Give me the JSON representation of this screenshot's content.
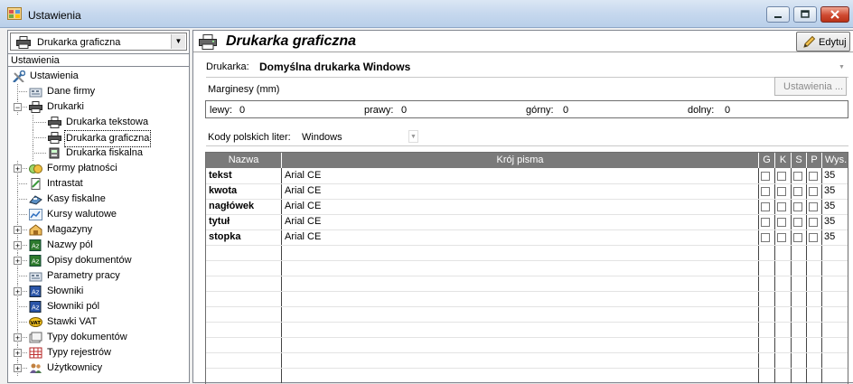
{
  "window": {
    "title": "Ustawienia"
  },
  "left": {
    "combo_value": "Drukarka graficzna",
    "tree_header": "Ustawienia",
    "tree": [
      {
        "label": "Ustawienia",
        "level": 0,
        "expander": "",
        "icon": "tools"
      },
      {
        "label": "Dane firmy",
        "level": 1,
        "expander": "",
        "icon": "building"
      },
      {
        "label": "Drukarki",
        "level": 1,
        "expander": "−",
        "icon": "printer"
      },
      {
        "label": "Drukarka tekstowa",
        "level": 2,
        "expander": "",
        "icon": "printer"
      },
      {
        "label": "Drukarka graficzna",
        "level": 2,
        "expander": "",
        "icon": "printer",
        "selected": true
      },
      {
        "label": "Drukarka fiskalna",
        "level": 2,
        "expander": "",
        "icon": "fiscal"
      },
      {
        "label": "Formy płatności",
        "level": 1,
        "expander": "+",
        "icon": "money"
      },
      {
        "label": "Intrastat",
        "level": 1,
        "expander": "",
        "icon": "document"
      },
      {
        "label": "Kasy fiskalne",
        "level": 1,
        "expander": "",
        "icon": "cashbox"
      },
      {
        "label": "Kursy walutowe",
        "level": 1,
        "expander": "",
        "icon": "chart"
      },
      {
        "label": "Magazyny",
        "level": 1,
        "expander": "+",
        "icon": "warehouse"
      },
      {
        "label": "Nazwy pól",
        "level": 1,
        "expander": "+",
        "icon": "az"
      },
      {
        "label": "Opisy dokumentów",
        "level": 1,
        "expander": "+",
        "icon": "az"
      },
      {
        "label": "Parametry pracy",
        "level": 1,
        "expander": "",
        "icon": "building"
      },
      {
        "label": "Słowniki",
        "level": 1,
        "expander": "+",
        "icon": "az-blue"
      },
      {
        "label": "Słowniki pól",
        "level": 1,
        "expander": "",
        "icon": "az-blue"
      },
      {
        "label": "Stawki VAT",
        "level": 1,
        "expander": "",
        "icon": "vat"
      },
      {
        "label": "Typy dokumentów",
        "level": 1,
        "expander": "+",
        "icon": "folders"
      },
      {
        "label": "Typy rejestrów",
        "level": 1,
        "expander": "+",
        "icon": "register"
      },
      {
        "label": "Użytkownicy",
        "level": 1,
        "expander": "+",
        "icon": "users"
      }
    ]
  },
  "right": {
    "title": "Drukarka graficzna",
    "edit_label": "Edytuj",
    "printer_label": "Drukarka:",
    "printer_value": "Domyślna drukarka Windows",
    "margins_label": "Marginesy (mm)",
    "settings_label": "Ustawienia ...",
    "margins": [
      {
        "label": "lewy:",
        "value": "0"
      },
      {
        "label": "prawy:",
        "value": "0"
      },
      {
        "label": "górny:",
        "value": "0"
      },
      {
        "label": "dolny:",
        "value": "0"
      }
    ],
    "kody_label": "Kody polskich liter:",
    "kody_value": "Windows",
    "grid": {
      "headers": [
        "Nazwa",
        "Krój pisma",
        "G",
        "K",
        "S",
        "P",
        "Wys."
      ],
      "rows": [
        {
          "name": "tekst",
          "font": "Arial CE",
          "size": "35"
        },
        {
          "name": "kwota",
          "font": "Arial CE",
          "size": "35"
        },
        {
          "name": "nagłówek",
          "font": "Arial CE",
          "size": "35"
        },
        {
          "name": "tytuł",
          "font": "Arial CE",
          "size": "35"
        },
        {
          "name": "stopka",
          "font": "Arial CE",
          "size": "35"
        }
      ]
    }
  }
}
